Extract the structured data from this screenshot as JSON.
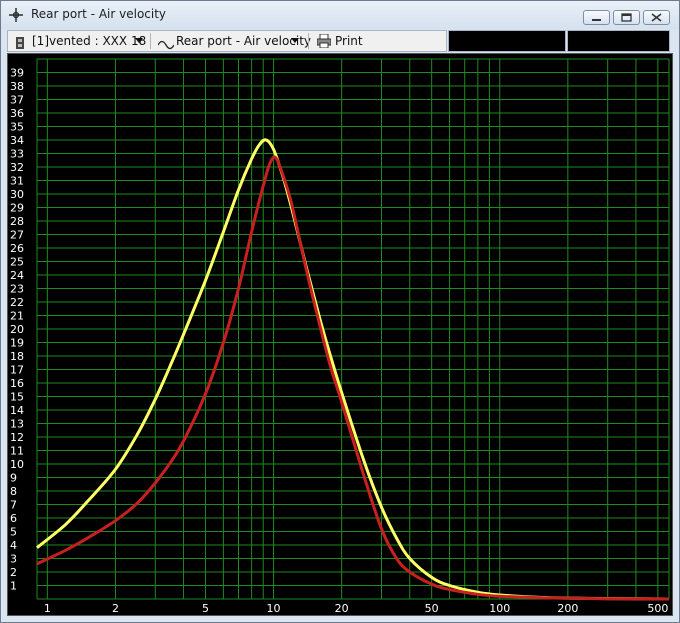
{
  "window": {
    "title": "Rear port - Air velocity",
    "title_icon": "crosshair-icon"
  },
  "toolbar": {
    "config_label": "[1]vented : XXX 18",
    "config_icon": "speaker-icon",
    "graph_label": "Rear port - Air velocity",
    "graph_icon": "sine-wave-icon",
    "print_label": "Print",
    "print_icon": "printer-icon"
  },
  "chart_data": {
    "type": "line",
    "title": "",
    "xlabel": "",
    "ylabel": "",
    "x_scale": "log",
    "xlim": [
      0.9,
      560
    ],
    "ylim": [
      0,
      40
    ],
    "grid": true,
    "background": "#000000",
    "grid_color": "#1e8c1e",
    "y_ticks": [
      1,
      2,
      3,
      4,
      5,
      6,
      7,
      8,
      9,
      10,
      11,
      12,
      13,
      14,
      15,
      16,
      17,
      18,
      19,
      20,
      21,
      22,
      23,
      24,
      25,
      26,
      27,
      28,
      29,
      30,
      31,
      32,
      33,
      34,
      35,
      36,
      37,
      38,
      39
    ],
    "x_ticks": [
      1,
      2,
      5,
      10,
      20,
      50,
      100,
      200,
      500
    ],
    "x_tick_labels": [
      "1",
      "2",
      "5",
      "10",
      "20",
      "50",
      "100",
      "200",
      "500"
    ],
    "series": [
      {
        "color": "#ffff66",
        "points": [
          [
            0.9,
            3.8
          ],
          [
            1.2,
            5.5
          ],
          [
            1.5,
            7.2
          ],
          [
            2,
            9.6
          ],
          [
            2.5,
            12.2
          ],
          [
            3,
            14.8
          ],
          [
            3.5,
            17.3
          ],
          [
            4,
            19.6
          ],
          [
            5,
            23.6
          ],
          [
            6,
            27.2
          ],
          [
            7,
            30.3
          ],
          [
            8,
            32.6
          ],
          [
            8.7,
            33.7
          ],
          [
            9.3,
            34.0
          ],
          [
            10,
            33.3
          ],
          [
            11,
            31.3
          ],
          [
            12,
            29.0
          ],
          [
            14,
            24.5
          ],
          [
            16,
            20.8
          ],
          [
            18,
            17.8
          ],
          [
            20,
            15.3
          ],
          [
            25,
            10.3
          ],
          [
            30,
            6.8
          ],
          [
            35,
            4.5
          ],
          [
            40,
            3.0
          ],
          [
            50,
            1.6
          ],
          [
            60,
            1.0
          ],
          [
            80,
            0.5
          ],
          [
            100,
            0.3
          ],
          [
            150,
            0.12
          ],
          [
            200,
            0.07
          ],
          [
            300,
            0.03
          ],
          [
            560,
            0.0
          ]
        ]
      },
      {
        "color": "#c82020",
        "points": [
          [
            0.9,
            2.6
          ],
          [
            1.2,
            3.6
          ],
          [
            1.5,
            4.5
          ],
          [
            2,
            5.8
          ],
          [
            2.5,
            7.1
          ],
          [
            3,
            8.6
          ],
          [
            3.5,
            10.1
          ],
          [
            4,
            11.7
          ],
          [
            5,
            15.2
          ],
          [
            6,
            19.0
          ],
          [
            7,
            23.0
          ],
          [
            8,
            27.2
          ],
          [
            9,
            30.6
          ],
          [
            9.6,
            32.2
          ],
          [
            10.2,
            32.7
          ],
          [
            11,
            31.4
          ],
          [
            12,
            29.3
          ],
          [
            14,
            24.3
          ],
          [
            16,
            20.3
          ],
          [
            18,
            17.0
          ],
          [
            20,
            14.6
          ],
          [
            25,
            9.2
          ],
          [
            30,
            5.2
          ],
          [
            35,
            3.0
          ],
          [
            40,
            2.0
          ],
          [
            50,
            1.1
          ],
          [
            60,
            0.7
          ],
          [
            80,
            0.35
          ],
          [
            100,
            0.2
          ],
          [
            150,
            0.1
          ],
          [
            200,
            0.05
          ],
          [
            300,
            0.02
          ],
          [
            560,
            0.0
          ]
        ]
      }
    ]
  }
}
